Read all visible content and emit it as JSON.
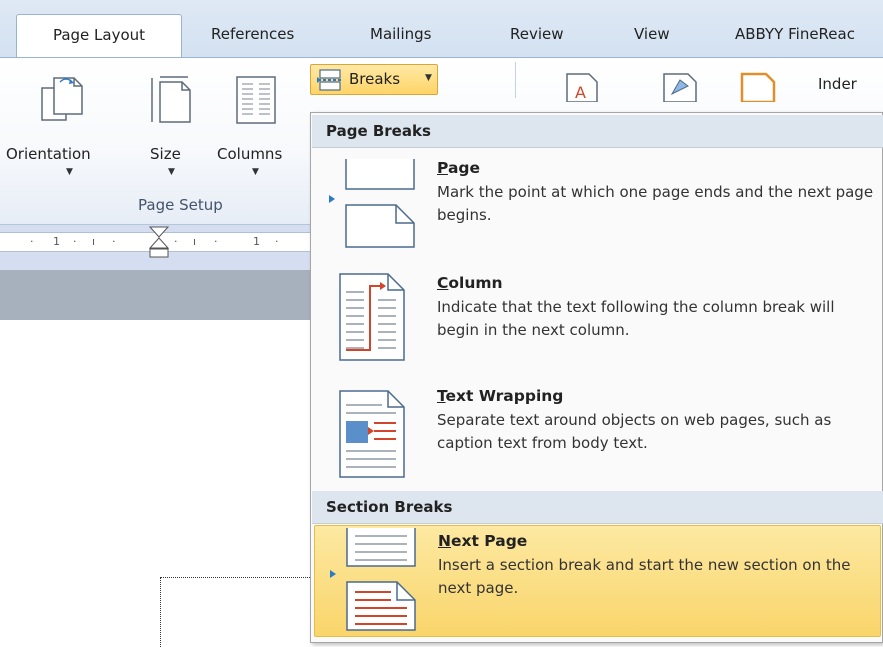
{
  "tabs": [
    {
      "label": "Page Layout",
      "active": true
    },
    {
      "label": "References",
      "active": false
    },
    {
      "label": "Mailings",
      "active": false
    },
    {
      "label": "Review",
      "active": false
    },
    {
      "label": "View",
      "active": false
    },
    {
      "label": "ABBYY FineReac",
      "active": false
    }
  ],
  "ribbon": {
    "orientation_label": "Orientation",
    "size_label": "Size",
    "columns_label": "Columns",
    "breaks_label": "Breaks",
    "indent_label": "Inder",
    "group_page_setup": "Page Setup"
  },
  "ruler": {
    "marks": [
      "1",
      "1"
    ]
  },
  "menu": {
    "section1_header": "Page Breaks",
    "section2_header": "Section Breaks",
    "items": [
      {
        "title_ul": "P",
        "title_rest": "age",
        "description": "Mark the point at which one page ends and the next page begins.",
        "selected": false
      },
      {
        "title_ul": "C",
        "title_rest": "olumn",
        "description": "Indicate that the text following the column break will begin in the next column.",
        "selected": false
      },
      {
        "title_ul": "T",
        "title_rest": "ext Wrapping",
        "description": "Separate text around objects on web pages, such as caption text from body text.",
        "selected": false
      },
      {
        "title_ul": "N",
        "title_rest": "ext Page",
        "description": "Insert a section break and start the new section on the next page.",
        "selected": true
      }
    ]
  },
  "colors": {
    "selection": "#f9d56b",
    "ribbon_tab_bg": "#dfe9f5",
    "accent_red": "#d2452b",
    "accent_blue": "#2b79c8"
  }
}
